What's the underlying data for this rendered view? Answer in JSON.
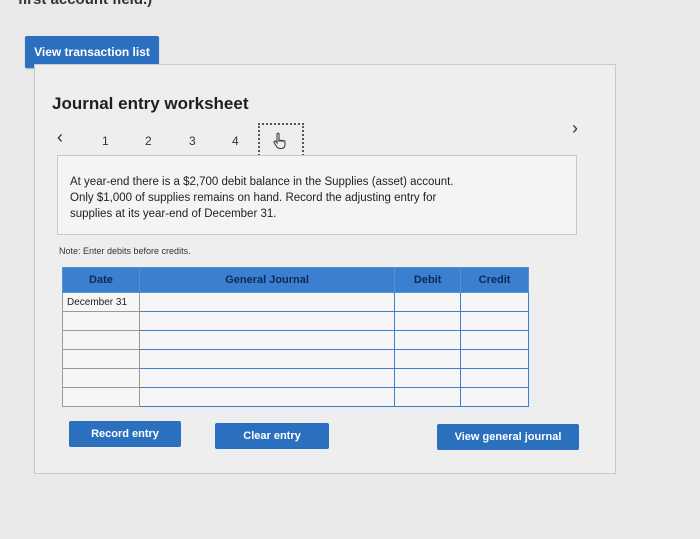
{
  "header": {
    "cut_text": "first account field.)"
  },
  "view_transaction_list": "View transaction list",
  "worksheet": {
    "title": "Journal entry worksheet",
    "pages": [
      "1",
      "2",
      "3",
      "4"
    ],
    "current_tab_icon": "hand-pointer-icon",
    "prev_icon": "chevron-left-icon",
    "next_icon": "chevron-right-icon",
    "description_lines": [
      "At year-end there is a $2,700 debit balance in the Supplies (asset) account.",
      "Only $1,000 of supplies remains on hand. Record the adjusting entry for",
      "supplies at its year-end of December 31."
    ],
    "note": "Note: Enter debits before credits."
  },
  "table": {
    "headers": {
      "date": "Date",
      "journal": "General Journal",
      "debit": "Debit",
      "credit": "Credit"
    },
    "rows": [
      {
        "date": "December 31",
        "journal": "",
        "debit": "",
        "credit": ""
      },
      {
        "date": "",
        "journal": "",
        "debit": "",
        "credit": ""
      },
      {
        "date": "",
        "journal": "",
        "debit": "",
        "credit": ""
      },
      {
        "date": "",
        "journal": "",
        "debit": "",
        "credit": ""
      },
      {
        "date": "",
        "journal": "",
        "debit": "",
        "credit": ""
      },
      {
        "date": "",
        "journal": "",
        "debit": "",
        "credit": ""
      }
    ]
  },
  "buttons": {
    "record": "Record entry",
    "clear": "Clear entry",
    "view_gj": "View general journal"
  }
}
